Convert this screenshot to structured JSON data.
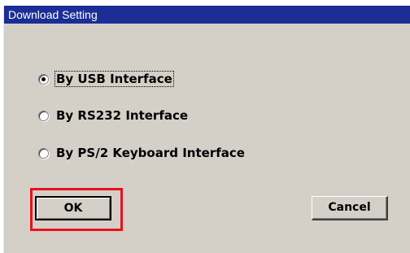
{
  "window": {
    "title": "Download Setting"
  },
  "options": [
    {
      "label": "By USB Interface",
      "selected": true
    },
    {
      "label": "By RS232 Interface",
      "selected": false
    },
    {
      "label": "By PS/2 Keyboard Interface",
      "selected": false
    }
  ],
  "buttons": {
    "ok_label": "OK",
    "cancel_label": "Cancel"
  },
  "colors": {
    "titlebar": "#1b2e96",
    "dialog_bg": "#d4d0c8",
    "highlight": "#e8121c"
  }
}
